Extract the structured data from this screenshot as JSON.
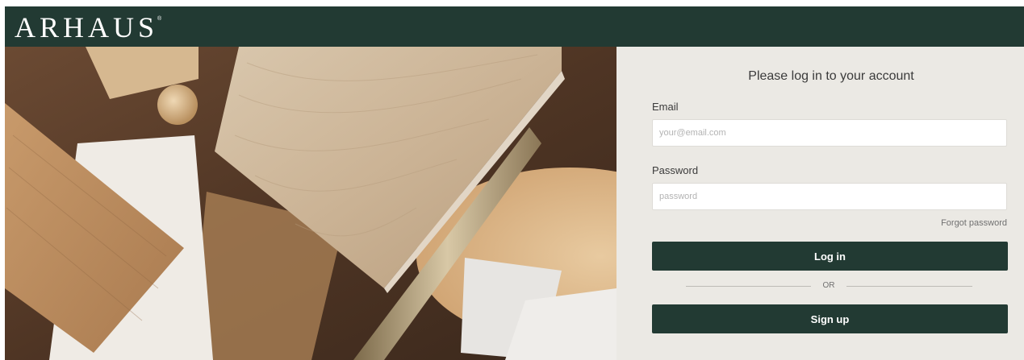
{
  "header": {
    "logo_text": "ARHAUS",
    "logo_mark": "®",
    "background": "#223a33"
  },
  "hero": {
    "icon": "wood-samples-photo"
  },
  "login": {
    "title": "Please log in to your account",
    "email_label": "Email",
    "email_placeholder": "your@email.com",
    "email_value": "",
    "password_label": "Password",
    "password_placeholder": "password",
    "password_value": "",
    "forgot_link": "Forgot password",
    "login_button": "Log in",
    "divider_text": "OR",
    "signup_button": "Sign up"
  },
  "colors": {
    "brand": "#223a33",
    "panel_background": "#ebe9e4"
  }
}
